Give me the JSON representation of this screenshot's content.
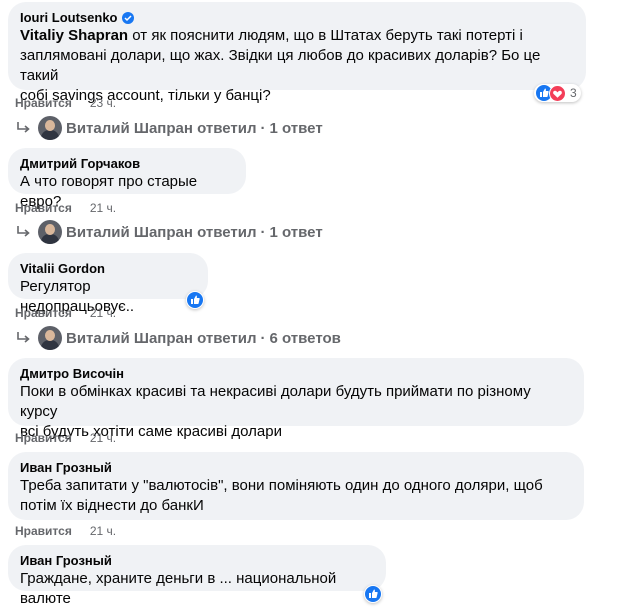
{
  "comments": [
    {
      "author": "Iouri Loutsenko",
      "mention": "Vitaliy Shapran",
      "text_first": " от як пояснити людям, що в Штатах беруть такі потерті і",
      "text_lines": [
        "заплямовані долари, що жах. Звідки ця любов до красивих доларів? Бо це такий",
        "собі savings account, тільки у банці?"
      ],
      "like_label": "Нравится",
      "time": "23 ч.",
      "reactions_count": "3",
      "reply": {
        "name": "Виталий Шапран ответил",
        "sep": "·",
        "count": "1 ответ"
      }
    },
    {
      "author": "Дмитрий Горчаков",
      "text_lines": [
        "А что говорят про старые евро?"
      ],
      "like_label": "Нравится",
      "time": "21 ч.",
      "reply": {
        "name": "Виталий Шапран ответил",
        "sep": "·",
        "count": "1 ответ"
      }
    },
    {
      "author": "Vitalii Gordon",
      "text_lines": [
        "Регулятор недопрацьовує.."
      ],
      "like_label": "Нравится",
      "time": "21 ч.",
      "reply": {
        "name": "Виталий Шапран ответил",
        "sep": "·",
        "count": "6 ответов"
      }
    },
    {
      "author": "Дмитро Височін",
      "text_lines": [
        "Поки в обмінках красиві та некрасиві долари будуть приймати по різному курсу",
        "всі будуть хотіти саме красиві долари"
      ],
      "like_label": "Нравится",
      "time": "21 ч."
    },
    {
      "author": "Иван Грозный",
      "text_lines": [
        "Треба запитати у \"валютосів\", вони поміняють один до одного доляри, щоб",
        "потім їх віднести до банкИ"
      ],
      "like_label": "Нравится",
      "time": "21 ч."
    },
    {
      "author": "Иван Грозный",
      "text_lines": [
        "Граждане, храните деньги в ... национальной валюте"
      ]
    }
  ]
}
